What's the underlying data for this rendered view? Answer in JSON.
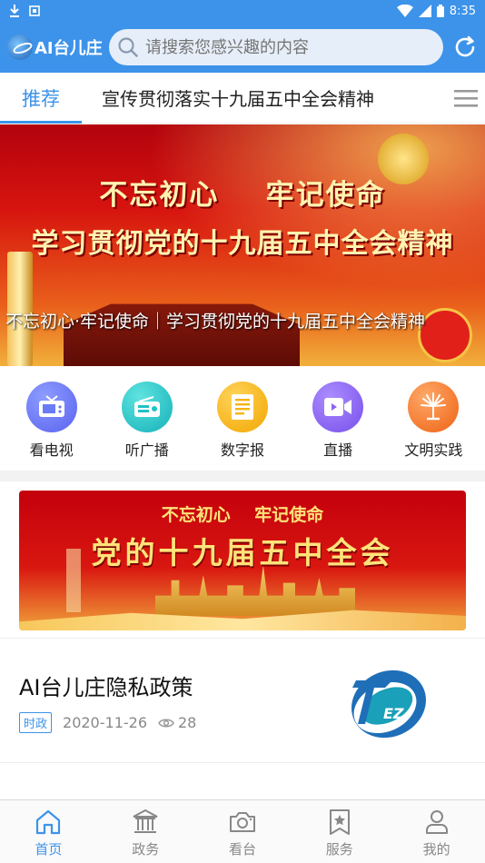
{
  "status_bar": {
    "time": "8:35"
  },
  "header": {
    "logo_text": "AI台儿庄",
    "search_placeholder": "请搜索您感兴趣的内容"
  },
  "tabs": [
    {
      "label": "推荐",
      "active": true
    },
    {
      "label": "宣传贯彻落实十九届五中全会精神",
      "active": false
    }
  ],
  "banner": {
    "headline_1": "不忘初心    牢记使命",
    "headline_2": "学习贯彻党的十九届五中全会精神",
    "caption": "不忘初心·牢记使命｜学习贯彻党的十九届五中全会精神"
  },
  "quick_links": [
    {
      "label": "看电视",
      "icon": "tv-icon",
      "color": "#6a7cf5"
    },
    {
      "label": "听广播",
      "icon": "radio-icon",
      "color": "#1fc3c6"
    },
    {
      "label": "数字报",
      "icon": "newspaper-icon",
      "color": "#f5b411"
    },
    {
      "label": "直播",
      "icon": "live-video-icon",
      "color": "#8a63f0"
    },
    {
      "label": "文明实践",
      "icon": "civilization-icon",
      "color": "#f27a2b"
    }
  ],
  "promo": {
    "line_1": "不忘初心    牢记使命",
    "line_2": "党的十九届五中全会"
  },
  "article": {
    "title": "AI台儿庄隐私政策",
    "tag": "时政",
    "date": "2020-11-26",
    "views": "28",
    "thumb_text": "EZ"
  },
  "bottom_nav": [
    {
      "label": "首页",
      "icon": "home-icon",
      "active": true
    },
    {
      "label": "政务",
      "icon": "government-icon",
      "active": false
    },
    {
      "label": "看台",
      "icon": "camera-icon",
      "active": false
    },
    {
      "label": "服务",
      "icon": "service-star-icon",
      "active": false
    },
    {
      "label": "我的",
      "icon": "user-icon",
      "active": false
    }
  ],
  "colors": {
    "brand": "#3d93e9",
    "inactive": "#888888"
  }
}
